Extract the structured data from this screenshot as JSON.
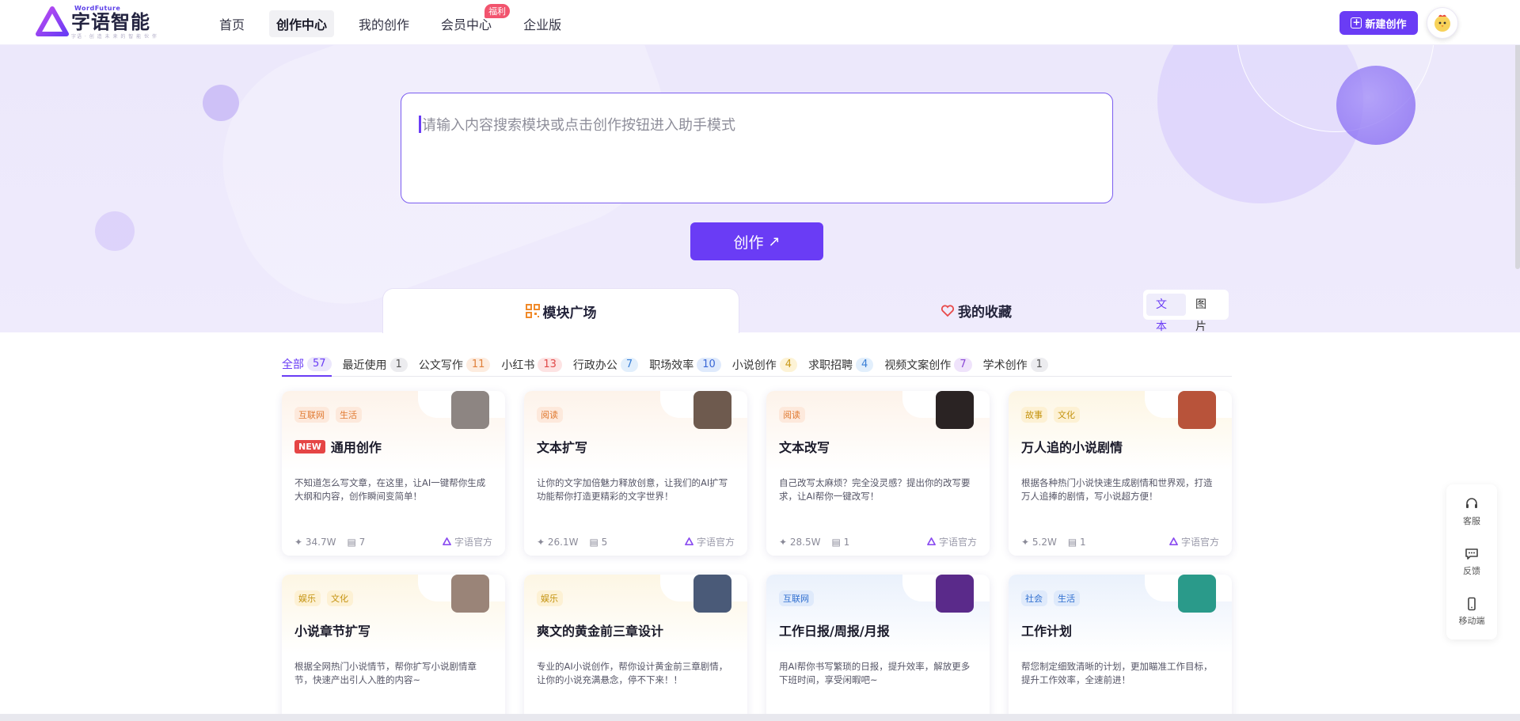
{
  "header": {
    "logo_en": "WordFuture",
    "logo_cn": "字语智能",
    "logo_sub": "字语 · 创 造 未 来 的 智 能 伙 伴",
    "nav": [
      {
        "label": "首页",
        "active": false
      },
      {
        "label": "创作中心",
        "active": true
      },
      {
        "label": "我的创作",
        "active": false
      },
      {
        "label": "会员中心",
        "active": false,
        "badge": "福利"
      },
      {
        "label": "企业版",
        "active": false
      }
    ],
    "new_button": "新建创作"
  },
  "hero": {
    "search_placeholder": "请输入内容搜索模块或点击创作按钮进入助手模式",
    "create_button": "创作"
  },
  "tabs": {
    "plaza": "模块广场",
    "favorites": "我的收藏",
    "toggle_text": "文本",
    "toggle_image": "图片"
  },
  "categories": [
    {
      "label": "全部",
      "count": "57",
      "bg": "#ebe7fc",
      "fg": "#6a3cf5"
    },
    {
      "label": "最近使用",
      "count": "1",
      "bg": "#ececef",
      "fg": "#555"
    },
    {
      "label": "公文写作",
      "count": "11",
      "bg": "#fdecdf",
      "fg": "#e0803a"
    },
    {
      "label": "小红书",
      "count": "13",
      "bg": "#fde3e3",
      "fg": "#e04848"
    },
    {
      "label": "行政办公",
      "count": "7",
      "bg": "#e2effc",
      "fg": "#3a7fd6"
    },
    {
      "label": "职场效率",
      "count": "10",
      "bg": "#dfeafc",
      "fg": "#3a67d6"
    },
    {
      "label": "小说创作",
      "count": "4",
      "bg": "#fdf3d6",
      "fg": "#c99a1a"
    },
    {
      "label": "求职招聘",
      "count": "4",
      "bg": "#e2effc",
      "fg": "#3a7fd6"
    },
    {
      "label": "视频文案创作",
      "count": "7",
      "bg": "#efe3fb",
      "fg": "#8a48d6"
    },
    {
      "label": "学术创作",
      "count": "1",
      "bg": "#ececef",
      "fg": "#555"
    }
  ],
  "cards": [
    {
      "title": "通用创作",
      "new": "NEW",
      "tags": [
        "互联网",
        "生活"
      ],
      "tag_style": "orange",
      "desc": "不知道怎么写文章，在这里，让AI一键帮你生成大纲和内容，创作瞬间变简单！",
      "uses": "34.7W",
      "comments": "7",
      "author": "字语官方",
      "top": "#fdf3ea",
      "thumb": "#8d8582"
    },
    {
      "title": "文本扩写",
      "tags": [
        "阅读"
      ],
      "tag_style": "orange",
      "desc": "让你的文字加倍魅力释放创意，让我们的AI扩写功能帮你打造更精彩的文字世界！",
      "uses": "26.1W",
      "comments": "5",
      "author": "字语官方",
      "top": "#fdf3ea",
      "thumb": "#6e5a4e"
    },
    {
      "title": "文本改写",
      "tags": [
        "阅读"
      ],
      "tag_style": "orange",
      "desc": "自己改写太麻烦？完全没灵感？提出你的改写要求，让AI帮你一键改写！",
      "uses": "28.5W",
      "comments": "1",
      "author": "字语官方",
      "top": "#fdf3ea",
      "thumb": "#2a2323"
    },
    {
      "title": "万人追的小说剧情",
      "tags": [
        "故事",
        "文化"
      ],
      "tag_style": "yellow",
      "desc": "根据各种热门小说快速生成剧情和世界观，打造万人追捧的剧情，写小说超方便！",
      "uses": "5.2W",
      "comments": "1",
      "author": "字语官方",
      "top": "#fdf6e4",
      "thumb": "#b8533a"
    },
    {
      "title": "小说章节扩写",
      "tags": [
        "娱乐",
        "文化"
      ],
      "tag_style": "yellow",
      "desc": "根据全网热门小说情节，帮你扩写小说剧情章节，快速产出引人入胜的内容~",
      "top": "#fdf6e4",
      "thumb": "#9a8478"
    },
    {
      "title": "爽文的黄金前三章设计",
      "tags": [
        "娱乐"
      ],
      "tag_style": "yellow",
      "desc": "专业的AI小说创作，帮你设计黄金前三章剧情，让你的小说充满悬念，停不下来！！",
      "top": "#fdf6e4",
      "thumb": "#4a5a78"
    },
    {
      "title": "工作日报/周报/月报",
      "tags": [
        "互联网"
      ],
      "tag_style": "blue",
      "desc": "用AI帮你书写繁琐的日报，提升效率，解放更多下班时间，享受闲暇吧~",
      "top": "#eaf1fc",
      "thumb": "#5a2a8a"
    },
    {
      "title": "工作计划",
      "tags": [
        "社会",
        "生活"
      ],
      "tag_style": "blue",
      "desc": "帮您制定细致清晰的计划，更加瞄准工作目标，提升工作效率，全速前进！",
      "top": "#eaf1fc",
      "thumb": "#2a9a8a"
    }
  ],
  "side": {
    "service": "客服",
    "feedback": "反馈",
    "mobile": "移动端"
  },
  "colors": {
    "accent": "#6a3cf5",
    "hero_bg": "#ece8fb"
  }
}
